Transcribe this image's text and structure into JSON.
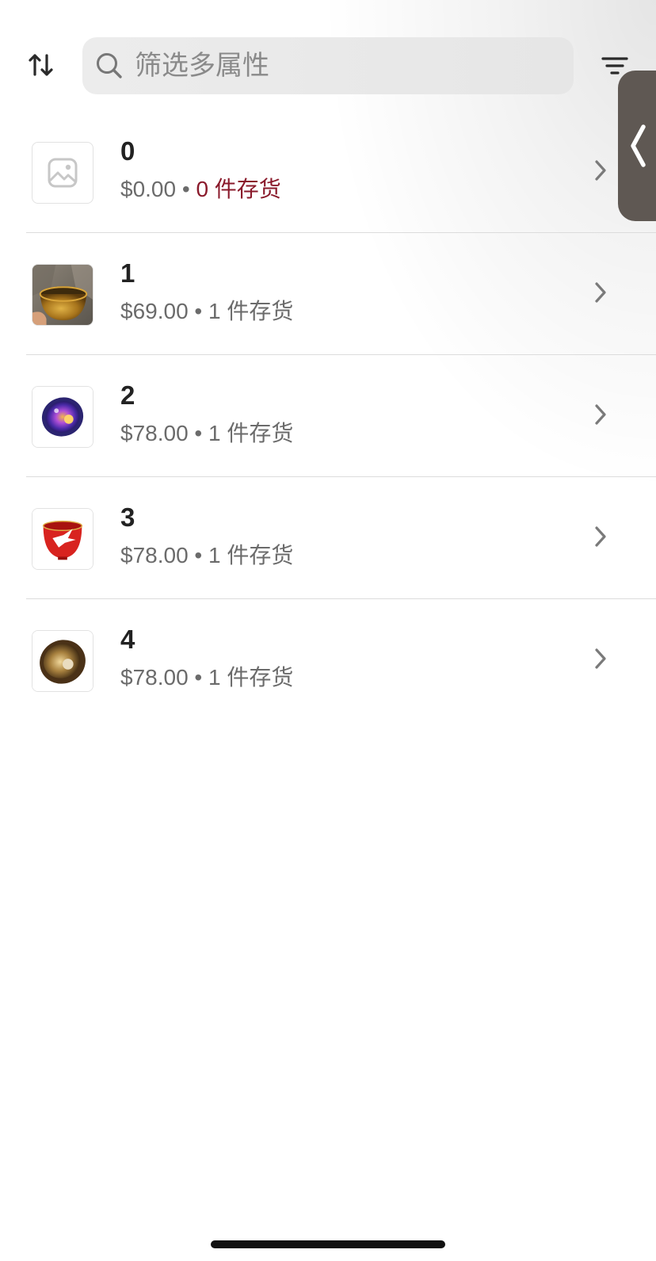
{
  "toolbar": {
    "sort_icon": "sort-arrows-icon",
    "filter_icon": "filter-lines-icon"
  },
  "search": {
    "placeholder": "筛选多属性",
    "value": "",
    "icon": "search-icon"
  },
  "drawer": {
    "icon": "chevron-left-icon",
    "color": "#5f5853"
  },
  "items": [
    {
      "title": "0",
      "price": "$0.00",
      "separator": "•",
      "stock": "0 件存货",
      "stock_low": true,
      "thumb": "placeholder-image-icon"
    },
    {
      "title": "1",
      "price": "$69.00",
      "separator": "•",
      "stock": "1 件存货",
      "stock_low": false,
      "thumb": "gold-cup-photo"
    },
    {
      "title": "2",
      "price": "$78.00",
      "separator": "•",
      "stock": "1 件存货",
      "stock_low": false,
      "thumb": "purple-cup-photo"
    },
    {
      "title": "3",
      "price": "$78.00",
      "separator": "•",
      "stock": "1 件存货",
      "stock_low": false,
      "thumb": "red-crane-cup-photo"
    },
    {
      "title": "4",
      "price": "$78.00",
      "separator": "•",
      "stock": "1 件存货",
      "stock_low": false,
      "thumb": "bronze-bowl-photo"
    }
  ],
  "colors": {
    "accent_low_stock": "#8a1a2b",
    "secondary_text": "#6b6b6b",
    "title_text": "#222222"
  }
}
